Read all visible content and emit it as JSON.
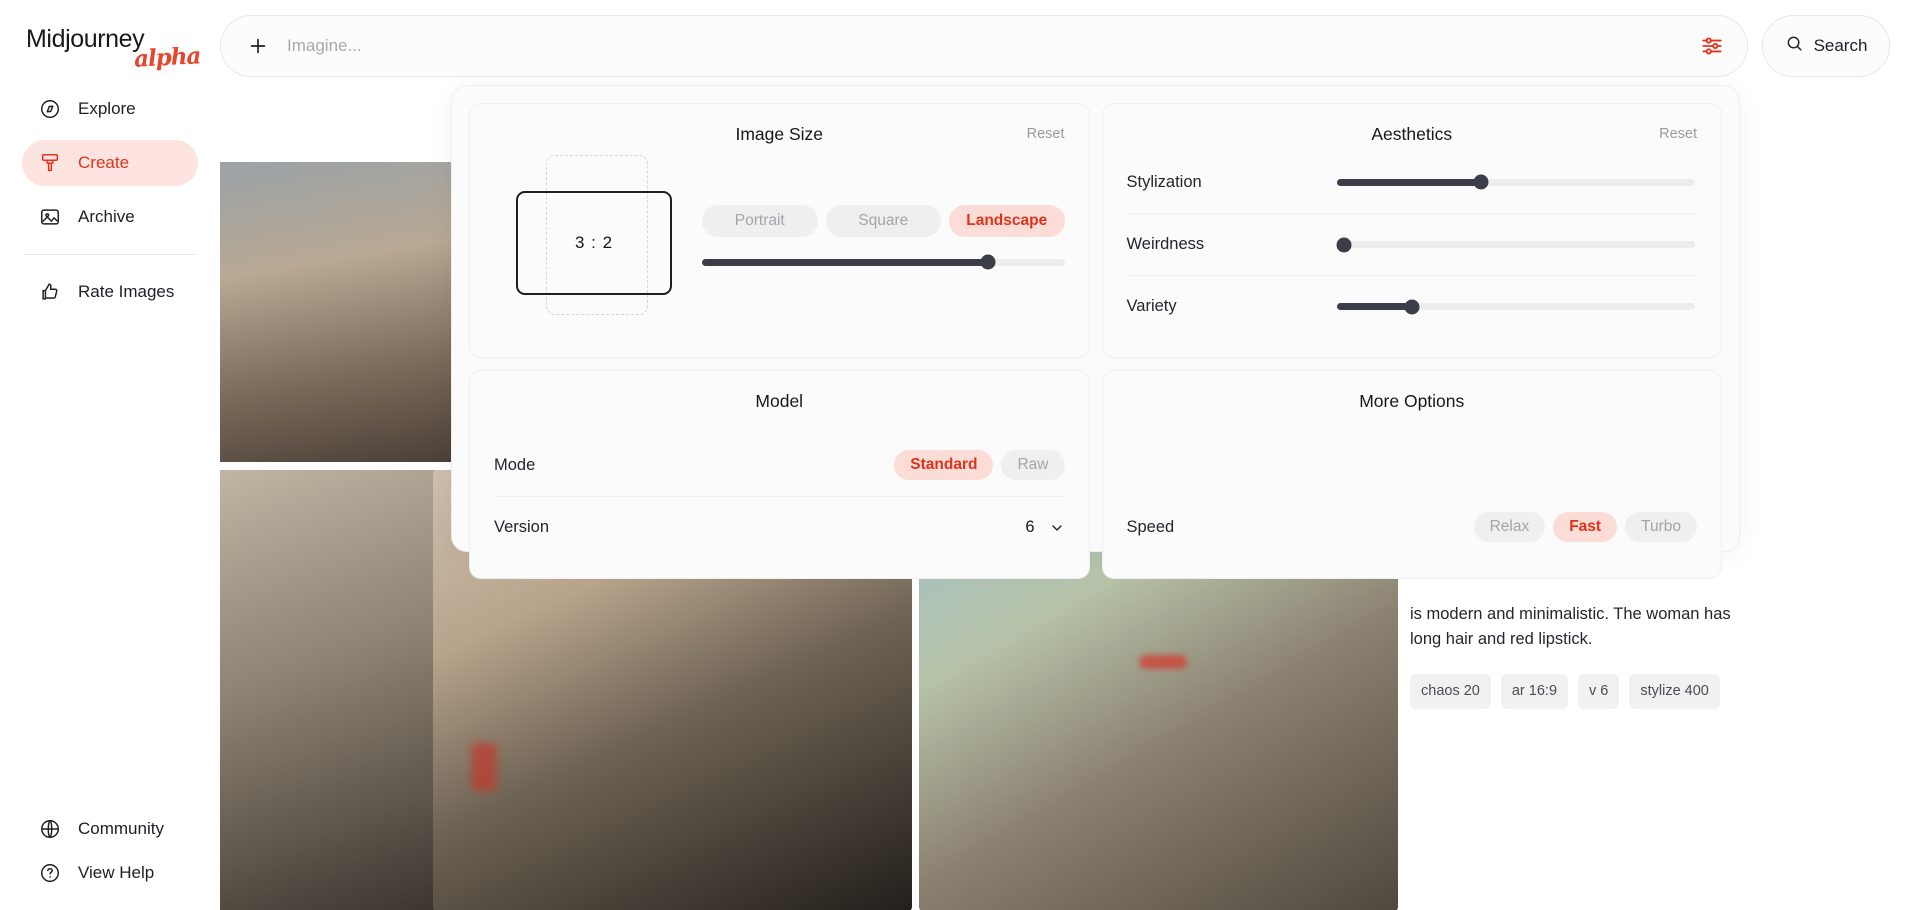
{
  "brand": {
    "name": "Midjourney",
    "tag": "alpha"
  },
  "sidebar": {
    "items": [
      {
        "label": "Explore",
        "icon": "compass-icon"
      },
      {
        "label": "Create",
        "icon": "brush-icon"
      },
      {
        "label": "Archive",
        "icon": "image-icon"
      },
      {
        "label": "Rate Images",
        "icon": "thumbs-up-icon"
      }
    ],
    "bottom": [
      {
        "label": "Community",
        "icon": "globe-icon"
      },
      {
        "label": "View Help",
        "icon": "question-circle-icon"
      }
    ]
  },
  "topbar": {
    "prompt_placeholder": "Imagine...",
    "prompt_value": "",
    "plus_icon": "plus-icon",
    "settings_icon": "sliders-icon",
    "search_label": "Search",
    "search_icon": "search-icon"
  },
  "settings": {
    "image_size": {
      "title": "Image Size",
      "reset_label": "Reset",
      "ratio_label": "3 : 2",
      "options": [
        "Portrait",
        "Square",
        "Landscape"
      ],
      "selected": "Landscape",
      "slider_percent": 80
    },
    "aesthetics": {
      "title": "Aesthetics",
      "reset_label": "Reset",
      "sliders": [
        {
          "label": "Stylization",
          "percent": 40
        },
        {
          "label": "Weirdness",
          "percent": 0
        },
        {
          "label": "Variety",
          "percent": 20
        }
      ]
    },
    "model": {
      "title": "Model",
      "mode_label": "Mode",
      "mode_options": [
        "Standard",
        "Raw"
      ],
      "mode_selected": "Standard",
      "version_label": "Version",
      "version_value": "6",
      "chevron_icon": "chevron-down-icon"
    },
    "more_options": {
      "title": "More Options",
      "speed_label": "Speed",
      "speed_options": [
        "Relax",
        "Fast",
        "Turbo"
      ],
      "speed_selected": "Fast"
    }
  },
  "gallery": {
    "description": "is modern and minimalistic. The woman has long hair and red lipstick.",
    "tags": [
      "chaos 20",
      "ar 16:9",
      "v 6",
      "stylize 400"
    ]
  },
  "colors": {
    "accent": "#e0331b",
    "accent_bg": "#fcdcd6",
    "sidebar_active_bg": "#fde4e0",
    "slider_fill": "#3b3d48"
  }
}
